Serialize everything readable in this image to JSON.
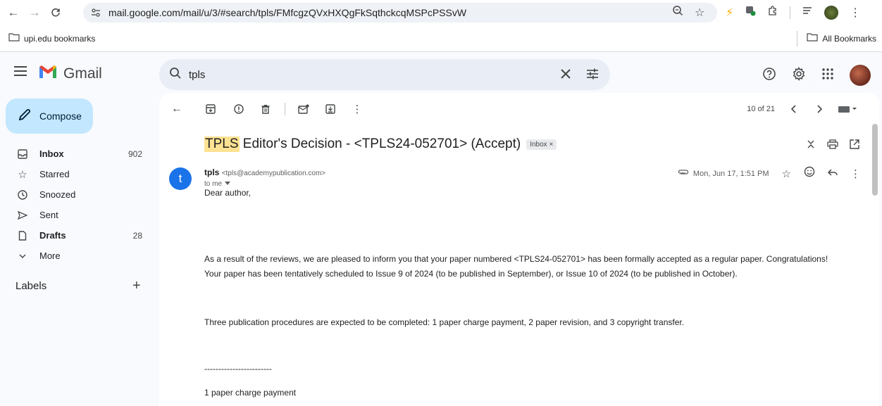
{
  "browser": {
    "url": "mail.google.com/mail/u/3/#search/tpls/FMfcgzQVxHXQgFkSqthckcqMSPcPSSvW",
    "bookmark_folder": "upi.edu bookmarks",
    "all_bookmarks": "All Bookmarks"
  },
  "gmail": {
    "logo_text": "Gmail",
    "search_value": "tpls",
    "compose_label": "Compose",
    "nav": [
      {
        "label": "Inbox",
        "count": "902"
      },
      {
        "label": "Starred",
        "count": ""
      },
      {
        "label": "Snoozed",
        "count": ""
      },
      {
        "label": "Sent",
        "count": ""
      },
      {
        "label": "Drafts",
        "count": "28"
      },
      {
        "label": "More",
        "count": ""
      }
    ],
    "labels_title": "Labels",
    "labels_add": "+"
  },
  "toolbar": {
    "pager": "10 of 21"
  },
  "message": {
    "subject_highlight": "TPLS",
    "subject_rest": " Editor's Decision - <TPLS24-052701> (Accept)",
    "inbox_tag": "Inbox ×",
    "sender_initial": "t",
    "sender_name": "tpls",
    "sender_email": "<tpls@academypublication.com>",
    "to_me": "to me",
    "date": "Mon, Jun 17, 1:51 PM",
    "body": [
      "Dear author,",
      "As a result of the reviews, we are pleased to inform you that your paper numbered <TPLS24-052701> has been formally accepted as a regular paper. Congratulations!",
      "Your paper has been tentatively scheduled to Issue 9 of 2024 (to be published in September), or Issue 10 of 2024 (to be published in October).",
      "Three publication procedures are expected to be completed: 1 paper charge payment, 2 paper revision, and 3 copyright transfer.",
      "------------------------",
      "1 paper charge payment"
    ]
  }
}
